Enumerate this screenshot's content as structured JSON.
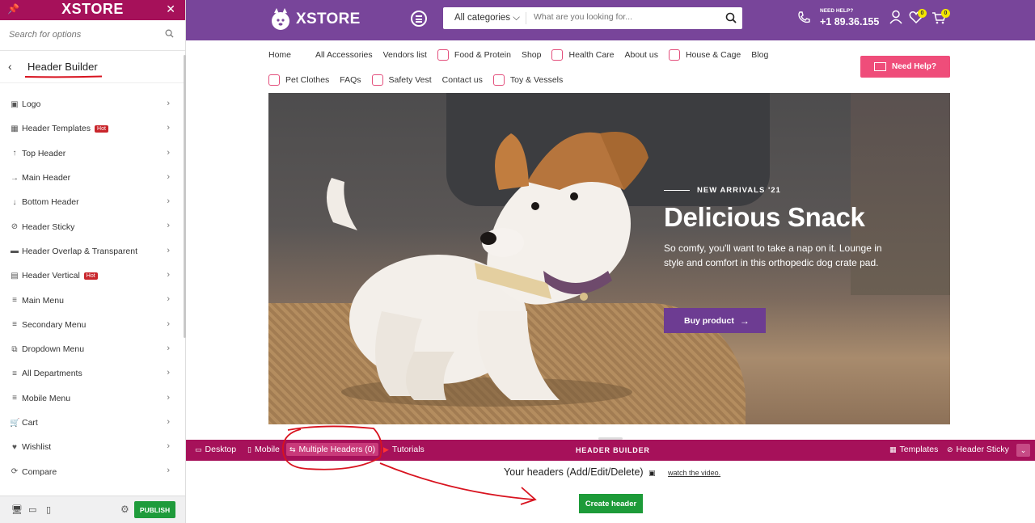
{
  "sidebar": {
    "brand": "XSTORE",
    "search_placeholder": "Search for options",
    "section_title": "Header Builder",
    "items": [
      {
        "label": "Logo",
        "icon": "image-icon",
        "hot": ""
      },
      {
        "label": "Header Templates",
        "icon": "grid-icon",
        "hot": "Hot"
      },
      {
        "label": "Top Header",
        "icon": "arrow-up-icon",
        "hot": ""
      },
      {
        "label": "Main Header",
        "icon": "arrow-right-icon",
        "hot": ""
      },
      {
        "label": "Bottom Header",
        "icon": "arrow-down-icon",
        "hot": ""
      },
      {
        "label": "Header Sticky",
        "icon": "pin-icon",
        "hot": ""
      },
      {
        "label": "Header Overlap & Transparent",
        "icon": "layers-icon",
        "hot": ""
      },
      {
        "label": "Header Vertical",
        "icon": "document-icon",
        "hot": "Hot"
      },
      {
        "label": "Main Menu",
        "icon": "menu-icon",
        "hot": ""
      },
      {
        "label": "Secondary Menu",
        "icon": "menu-icon",
        "hot": ""
      },
      {
        "label": "Dropdown Menu",
        "icon": "dropdown-icon",
        "hot": ""
      },
      {
        "label": "All Departments",
        "icon": "menu-icon",
        "hot": ""
      },
      {
        "label": "Mobile Menu",
        "icon": "menu-icon",
        "hot": ""
      },
      {
        "label": "Cart",
        "icon": "cart-icon",
        "hot": ""
      },
      {
        "label": "Wishlist",
        "icon": "heart-icon",
        "hot": ""
      },
      {
        "label": "Compare",
        "icon": "refresh-icon",
        "hot": ""
      }
    ],
    "publish_label": "PUBLISH"
  },
  "header": {
    "logo_text": "XSTORE",
    "search_category": "All categories",
    "search_placeholder": "What are you looking for...",
    "need_help": "NEED HELP?",
    "phone": "+1 89.36.155",
    "wishlist_count": "0",
    "cart_count": "0",
    "help_button": "Need Help?"
  },
  "nav": {
    "row1": [
      {
        "label": "Home",
        "icon": false
      },
      {
        "label": "All Accessories",
        "icon": false
      },
      {
        "label": "Vendors list",
        "icon": false
      },
      {
        "label": "Food & Protein",
        "icon": true
      },
      {
        "label": "Shop",
        "icon": false
      },
      {
        "label": "Health Care",
        "icon": true
      },
      {
        "label": "About us",
        "icon": false
      },
      {
        "label": "House & Cage",
        "icon": true
      },
      {
        "label": "Blog",
        "icon": false
      }
    ],
    "row2": [
      {
        "label": "Pet Clothes",
        "icon": true
      },
      {
        "label": "FAQs",
        "icon": false
      },
      {
        "label": "Safety Vest",
        "icon": true
      },
      {
        "label": "Contact us",
        "icon": false
      },
      {
        "label": "Toy & Vessels",
        "icon": true
      }
    ]
  },
  "hero": {
    "eyebrow": "NEW ARRIVALS '21",
    "title": "Delicious Snack",
    "text": "So comfy, you'll want to take a nap on it. Lounge in style and comfort in this orthopedic dog crate pad.",
    "button": "Buy product"
  },
  "builder": {
    "tabs": {
      "desktop": "Desktop",
      "mobile": "Mobile",
      "multiple": "Multiple Headers (0)",
      "tutorials": "Tutorials",
      "templates": "Templates",
      "sticky": "Header Sticky"
    },
    "center_title": "HEADER BUILDER",
    "headers_title": "Your headers (Add/Edit/Delete)",
    "watch_link": "watch the video.",
    "create_button": "Create header"
  },
  "colors": {
    "brand_purple": "#78459a",
    "builder_magenta": "#a6115a",
    "accent_pink": "#ef4d7a",
    "publish_green": "#1f9b3b",
    "annotation_red": "#d8131f"
  }
}
